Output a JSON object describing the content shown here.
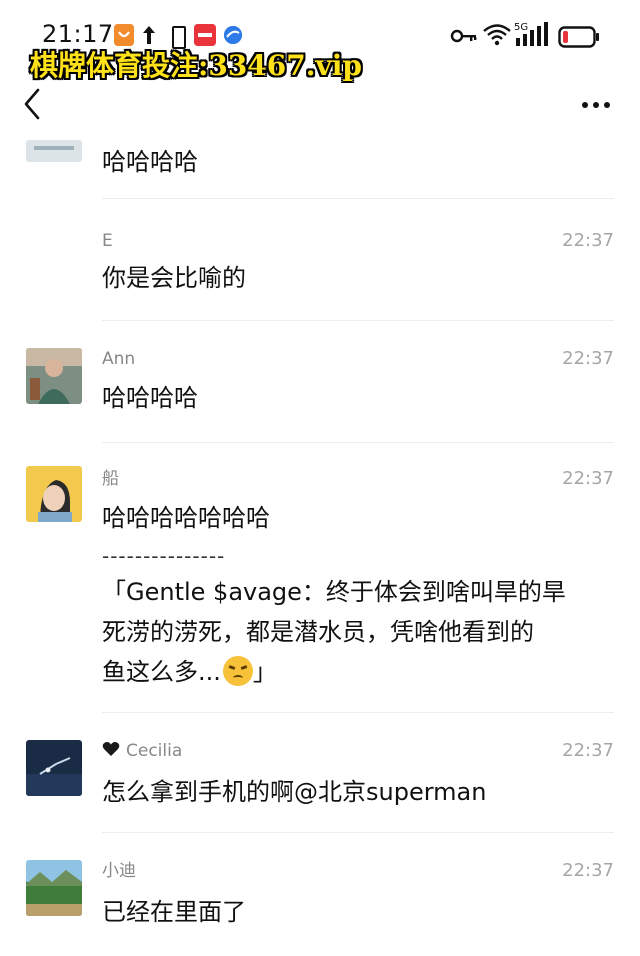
{
  "status_bar": {
    "time": "21:17",
    "network": "5G",
    "icons": [
      "app-notification-icon",
      "upload-icon",
      "small-battery-icon",
      "app-badge-icon",
      "app-globe-icon",
      "key-icon",
      "wifi-icon",
      "signal-icon",
      "battery-icon"
    ]
  },
  "watermark": "棋牌体育投注:33467.vip",
  "nav": {
    "back_icon": "chevron-left-icon",
    "more_icon": "more-dots-icon"
  },
  "messages": [
    {
      "sender": "",
      "time": "",
      "text": "哈哈哈哈",
      "avatar": "partial-avatar"
    },
    {
      "sender": "E",
      "time": "22:37",
      "text": "你是会比喻的",
      "avatar": "none"
    },
    {
      "sender": "Ann",
      "time": "22:37",
      "text": "哈哈哈哈",
      "avatar": "photo-avatar"
    },
    {
      "sender": "船",
      "time": "22:37",
      "text": "哈哈哈哈哈哈哈",
      "dashes": "---------------",
      "quote_lines": [
        "「Gentle $avage：终于体会到啥叫旱的旱",
        "死涝的涝死，都是潜水员，凭啥他看到的",
        "鱼这么多..."
      ],
      "quote_end": "」",
      "emoji": "angry-face-emoji",
      "avatar": "photo-avatar"
    },
    {
      "sender": "Cecilia",
      "sender_icon": "black-heart-icon",
      "time": "22:37",
      "text": "怎么拿到手机的啊@北京superman",
      "avatar": "photo-avatar"
    },
    {
      "sender": "小迪",
      "time": "22:37",
      "text": "已经在里面了",
      "avatar": "photo-avatar"
    }
  ],
  "colors": {
    "background": "#ffffff",
    "sender": "#888888",
    "timestamp": "#a6a6a6",
    "text": "#111111",
    "watermark": "#ffe11a"
  }
}
